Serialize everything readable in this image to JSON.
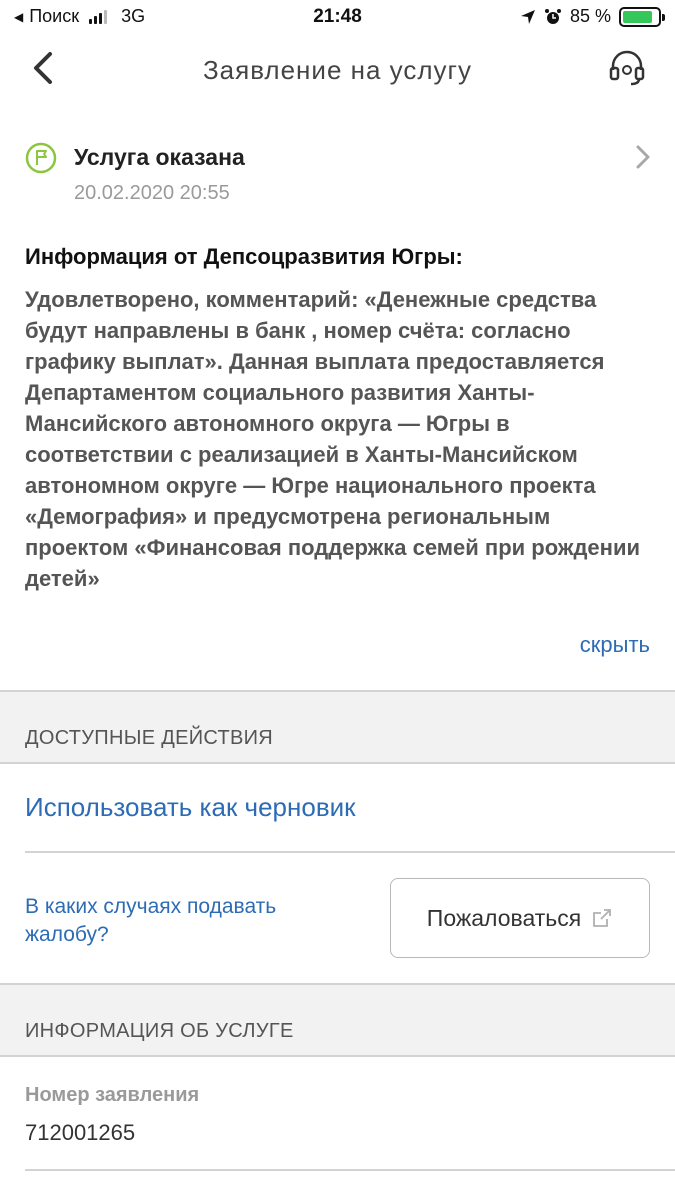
{
  "status_bar": {
    "carrier": "Поиск",
    "network": "3G",
    "time": "21:48",
    "battery_percent": "85 %",
    "battery_level": 0.85
  },
  "nav": {
    "title": "Заявление на услугу"
  },
  "service_status": {
    "title": "Услуга оказана",
    "date": "20.02.2020 20:55"
  },
  "info": {
    "heading": "Информация от Депсоцразвития Югры:",
    "text": "Удовлетворено, комментарий: «Денежные средства будут направлены в банк , номер счёта: согласно графику выплат». Данная выплата предоставляется Департаментом социального развития Ханты-Мансийского автономного округа — Югры в соответствии с реализацией в Ханты-Мансийском автономном округе — Югре национального проекта «Демография» и предусмотрена региональным проектом «Финансовая поддержка семей при рождении детей»",
    "hide_label": "скрыть"
  },
  "actions": {
    "section_title": "ДОСТУПНЫЕ ДЕЙСТВИЯ",
    "use_as_draft": "Использовать как черновик",
    "complaint_help": "В каких случаях подавать жалобу?",
    "complaint_button": "Пожаловаться"
  },
  "service_info": {
    "section_title": "ИНФОРМАЦИЯ ОБ УСЛУГЕ",
    "application_number_label": "Номер заявления",
    "application_number": "712001265"
  },
  "colors": {
    "link": "#2d6cb5",
    "status_green": "#8cc63f",
    "battery_green": "#34c759"
  }
}
